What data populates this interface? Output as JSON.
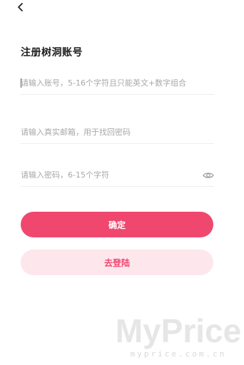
{
  "header": {
    "back_icon": "chevron-left-icon",
    "title": "注册树洞账号"
  },
  "form": {
    "account_placeholder": "请输入账号，5-16个字符且只能英文+数字组合",
    "email_placeholder": "请输入真实邮箱，用于找回密码",
    "password_placeholder": "请输入密码，6-15个字符",
    "password_toggle_icon": "eye-icon"
  },
  "actions": {
    "confirm_label": "确定",
    "login_label": "去登陆"
  },
  "watermark": {
    "logo_text": "MyPrice",
    "url_text": "myprice.com.cn"
  },
  "colors": {
    "accent": "#f0476f",
    "accent_light": "#fde6ec",
    "placeholder": "#a8a8a8",
    "divider": "#eeeeee"
  }
}
